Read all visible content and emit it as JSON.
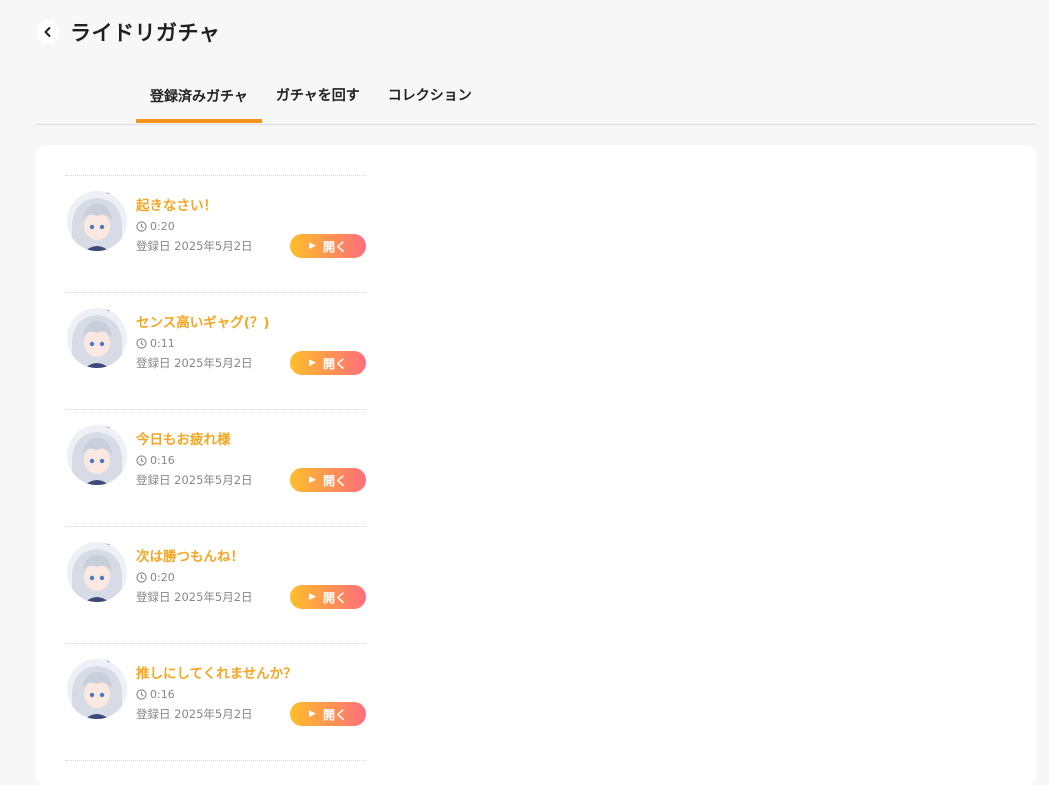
{
  "header": {
    "title": "ライドリガチャ"
  },
  "tabs": [
    {
      "label": "登録済みガチャ",
      "active": true
    },
    {
      "label": "ガチャを回す",
      "active": false
    },
    {
      "label": "コレクション",
      "active": false
    }
  ],
  "items": [
    {
      "title": "起きなさい！",
      "duration": "0:20",
      "date": "登録日  2025年5月2日",
      "button": "開く"
    },
    {
      "title": "センス高いギャグ(？)",
      "duration": "0:11",
      "date": "登録日  2025年5月2日",
      "button": "開く"
    },
    {
      "title": "今日もお疲れ様",
      "duration": "0:16",
      "date": "登録日  2025年5月2日",
      "button": "開く"
    },
    {
      "title": "次は勝つもんね！",
      "duration": "0:20",
      "date": "登録日  2025年5月2日",
      "button": "開く"
    },
    {
      "title": "推しにしてくれませんか？",
      "duration": "0:16",
      "date": "登録日  2025年5月2日",
      "button": "開く"
    }
  ],
  "icons": {
    "back": "chevron-left-icon",
    "clock": "clock-icon",
    "play": "play-icon",
    "avatar": "character-avatar"
  },
  "colors": {
    "accent": "#f7931e",
    "item_title": "#f5a623",
    "button_start": "#ffbe2b",
    "button_end": "#ff6e7f"
  }
}
